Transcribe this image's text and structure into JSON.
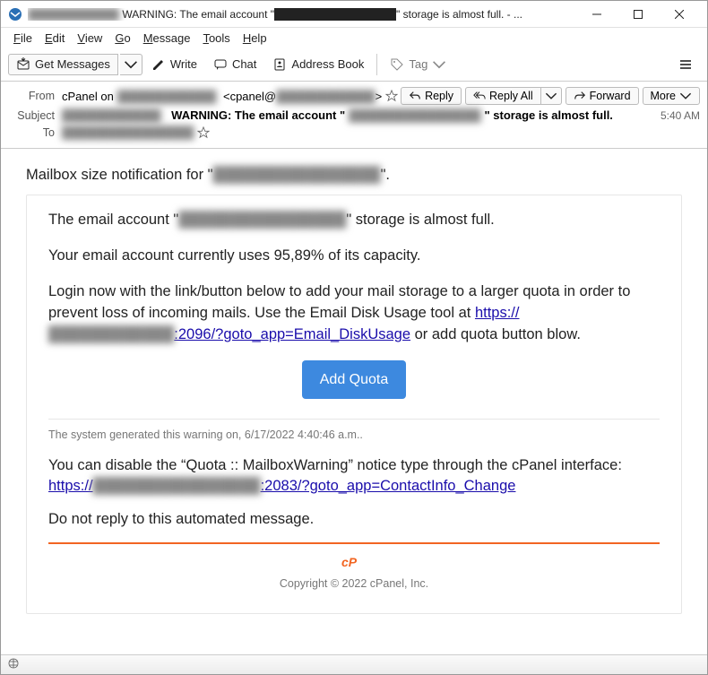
{
  "window": {
    "title_prefix": "████████████",
    "title_main": " WARNING: The email account \"████████████████\" storage is almost full. - ..."
  },
  "menu": {
    "file": "File",
    "edit": "Edit",
    "view": "View",
    "go": "Go",
    "message": "Message",
    "tools": "Tools",
    "help": "Help"
  },
  "toolbar": {
    "get": "Get Messages",
    "write": "Write",
    "chat": "Chat",
    "address": "Address Book",
    "tag": "Tag"
  },
  "headers": {
    "from_label": "From",
    "from_text": "cPanel on",
    "from_domain": "████████████",
    "from_email": "<cpanel@████████████>",
    "subject_label": "Subject",
    "subject_domain": "████████████",
    "subject_main": "WARNING: The email account \"",
    "subject_acct": "████████████████",
    "subject_tail": "\" storage is almost full.",
    "to_label": "To",
    "to_acct": "████████████████",
    "time": "5:40 AM",
    "reply": "Reply",
    "replyall": "Reply All",
    "forward": "Forward",
    "more": "More"
  },
  "body": {
    "notif_pre": "Mailbox size notification for \"",
    "notif_acct": "████████████████",
    "notif_post": "\".",
    "l1a": "The email account \"",
    "l1acct": "████████████████",
    "l1b": "\" storage is almost full.",
    "l2": "Your email account currently uses 95,89% of its capacity.",
    "l3": "Login now with the link/button below to add your mail storage to a larger quota in order to prevent loss of incoming mails. Use the Email Disk Usage tool at ",
    "link1a": "https://",
    "link1dom": "████████████",
    "link1b": ":2096/?goto_app=Email_DiskUsage",
    "l3tail": " or add quota button blow.",
    "btn": "Add Quota",
    "gen": "The system generated this warning on, 6/17/2022 4:40:46 a.m..",
    "d1": "You can disable the “Quota :: MailboxWarning” notice type through the cPanel interface: ",
    "link2a": "https://",
    "link2dom": "████████████████",
    "link2b": ":2083/?goto_app=ContactInfo_Change",
    "d2": "Do not reply to this automated message.",
    "copyright": "Copyright © 2022 cPanel, Inc."
  }
}
